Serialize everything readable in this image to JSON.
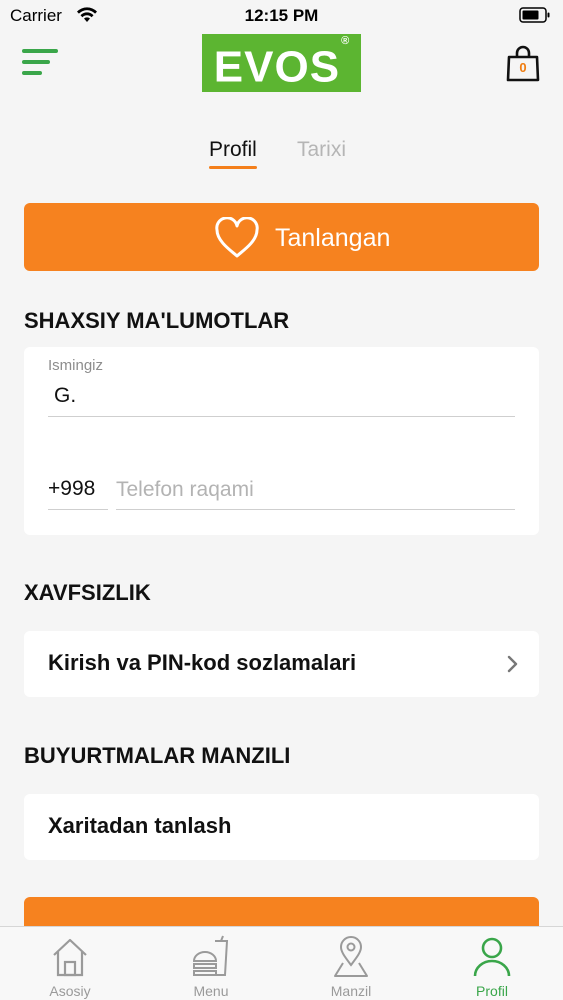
{
  "status_bar": {
    "carrier": "Carrier",
    "time": "12:15 PM"
  },
  "header": {
    "logo_text": "EVOS",
    "logo_mark": "®",
    "cart_count": "0"
  },
  "tabs": [
    {
      "label": "Profil",
      "active": true
    },
    {
      "label": "Tarixi",
      "active": false
    }
  ],
  "favorites_button": {
    "label": "Tanlangan",
    "icon": "heart-icon"
  },
  "personal": {
    "title": "SHAXSIY MA'LUMOTLAR",
    "name_label": "Ismingiz",
    "name_value": "G.",
    "phone_prefix": "+998",
    "phone_placeholder": "Telefon raqami"
  },
  "security": {
    "title": "XAVFSIZLIK",
    "item_label": "Kirish va PIN-kod sozlamalari"
  },
  "addresses": {
    "title": "BUYURTMALAR MANZILI",
    "item_label": "Xaritadan tanlash"
  },
  "bottom_nav": [
    {
      "label": "Asosiy",
      "icon": "home-icon",
      "active": false
    },
    {
      "label": "Menu",
      "icon": "burger-drink-icon",
      "active": false
    },
    {
      "label": "Manzil",
      "icon": "map-pin-icon",
      "active": false
    },
    {
      "label": "Profil",
      "icon": "user-icon",
      "active": true
    }
  ],
  "colors": {
    "accent": "#f6821f",
    "brand_green": "#5cb531",
    "active_nav": "#3aa64a"
  }
}
